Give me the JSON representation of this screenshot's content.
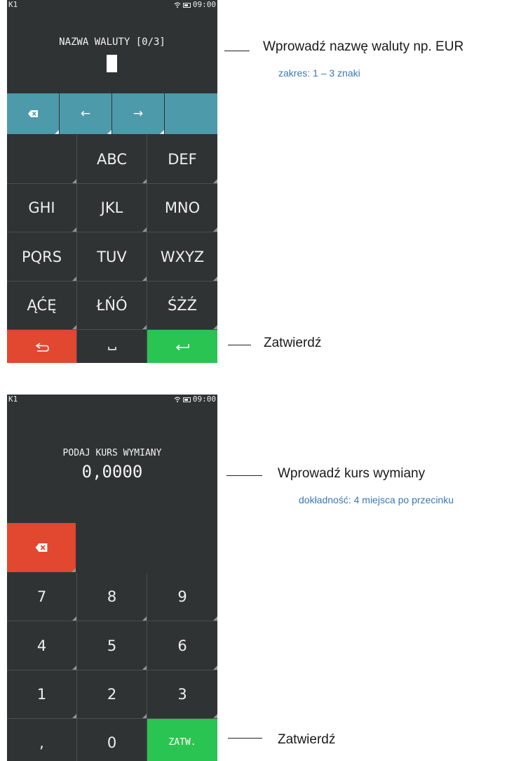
{
  "screen1": {
    "status": {
      "left": "K1",
      "time": "09:00"
    },
    "prompt": "NAZWA WALUTY [0/3]",
    "nav_keys": [
      "⌫",
      "←",
      "→",
      ""
    ],
    "keys": [
      [
        "",
        "ABC",
        "DEF"
      ],
      [
        "GHI",
        "JKL",
        "MNO"
      ],
      [
        "PQRS",
        "TUV",
        "WXYZ"
      ],
      [
        "ĄĆĘ",
        "ŁŃÓ",
        "ŚŻŹ"
      ]
    ],
    "bottom_keys": {
      "back": "⮌",
      "space": "␣",
      "enter": "↩"
    }
  },
  "screen2": {
    "status": {
      "left": "K1",
      "time": "09:00"
    },
    "prompt": "PODAJ KURS WYMIANY",
    "value": "0,0000",
    "keys": [
      [
        "7",
        "8",
        "9"
      ],
      [
        "4",
        "5",
        "6"
      ],
      [
        "1",
        "2",
        "3"
      ],
      [
        ",",
        "0",
        "ZATW."
      ]
    ]
  },
  "callouts": {
    "currency_name": "Wprowadź nazwę waluty np. EUR",
    "currency_range": "zakres: 1 – 3 znaki",
    "confirm1": "Zatwierdź",
    "rate": "Wprowadź kurs wymiany",
    "rate_precision": "dokładność: 4 miejsca po przecinku",
    "confirm2": "Zatwierdź"
  },
  "colors": {
    "screen_bg": "#2f3334",
    "teal": "#4d9aaa",
    "red": "#e2472f",
    "green": "#2ac452",
    "annotation_blue": "#3a78b4"
  },
  "icons": {
    "backspace": "backspace-icon",
    "wifi": "wifi-icon",
    "battery": "battery-icon"
  }
}
